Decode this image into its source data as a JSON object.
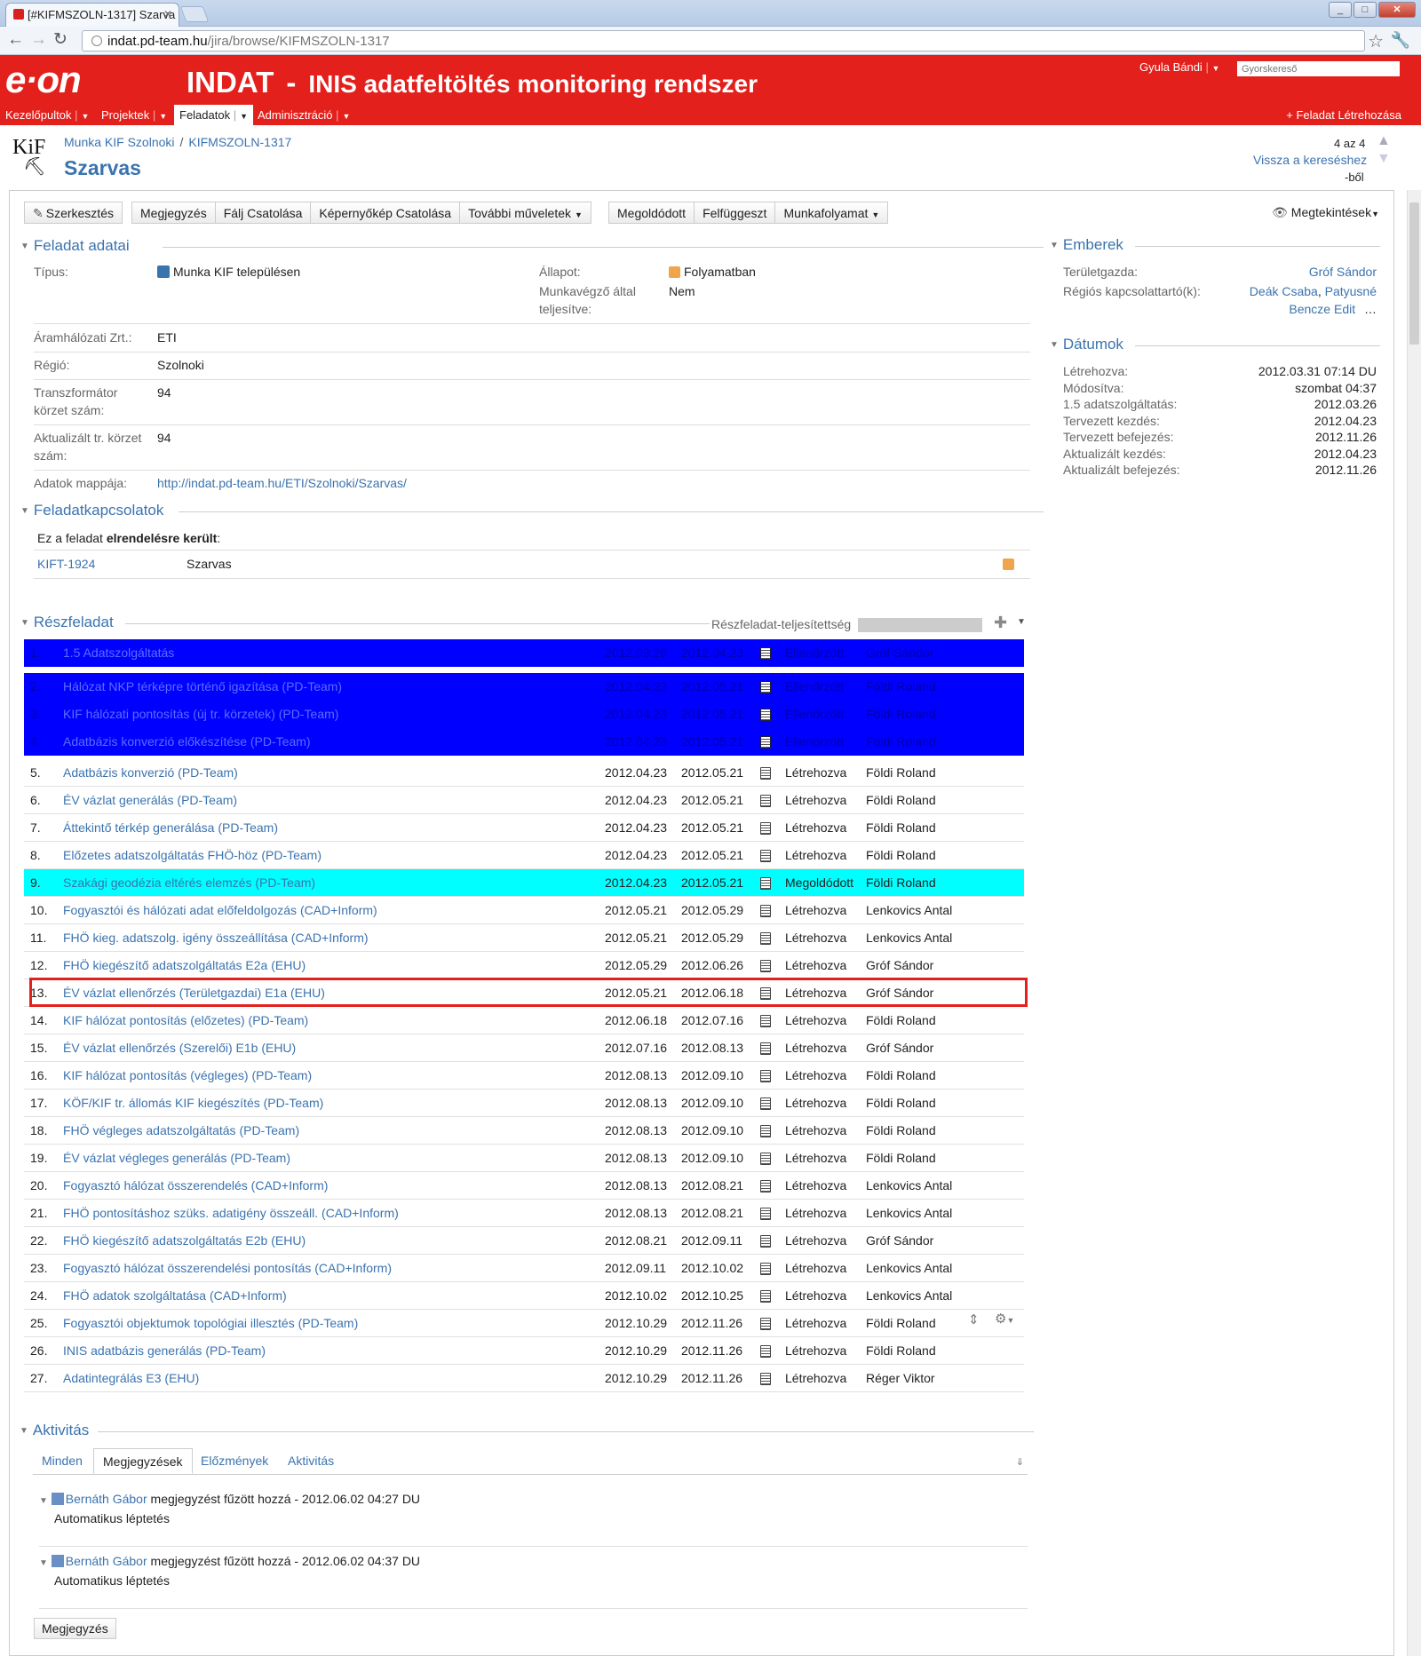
{
  "browser": {
    "tab_title": "[#KIFMSZOLN-1317] Szarva",
    "url_host": "indat.pd-team.hu",
    "url_path": "/jira/browse/KIFMSZOLN-1317"
  },
  "header": {
    "logo": "e·on",
    "app_name": "INDAT",
    "separator": "-",
    "app_subtitle": "INIS adatfeltöltés monitoring rendszer",
    "user": "Gyula Bándi",
    "search_placeholder": "Gyorskereső",
    "nav": [
      "Kezelőpultok",
      "Projektek",
      "Feladatok",
      "Adminisztráció"
    ],
    "create_issue": "+ Feladat Létrehozása"
  },
  "issue": {
    "project_avatar_text": "KiF",
    "breadcrumb_project": "Munka KIF Szolnoki",
    "breadcrumb_key": "KIFMSZOLN-1317",
    "summary": "Szarvas",
    "pager": "4 az 4",
    "back_link": "Vissza a kereséshez",
    "back_suffix": "-ből"
  },
  "toolbar": {
    "edit": "Szerkesztés",
    "group1": [
      "Megjegyzés",
      "Fálj Csatolása",
      "Képernyőkép Csatolása",
      "További műveletek"
    ],
    "group2": [
      "Megoldódott",
      "Felfüggeszt",
      "Munkafolyamat"
    ],
    "views": "Megtekintések"
  },
  "details": {
    "heading": "Feladat adatai",
    "type_label": "Típus:",
    "type_value": "Munka KIF településen",
    "status_label": "Állapot:",
    "status_value": "Folyamatban",
    "done_label_1": "Munkavégző által",
    "done_label_2": "teljesítve:",
    "done_value": "Nem",
    "fields": [
      {
        "label_1": "Áramhálózati Zrt.:",
        "label_2": "",
        "value": "ETI"
      },
      {
        "label_1": "Régió:",
        "label_2": "",
        "value": "Szolnoki"
      },
      {
        "label_1": "Transzformátor",
        "label_2": "körzet szám:",
        "value": "94"
      },
      {
        "label_1": "Aktualizált tr. körzet",
        "label_2": "szám:",
        "value": "94"
      }
    ],
    "folder_label": "Adatok mappája:",
    "folder_value": "http://indat.pd-team.hu/ETI/Szolnoki/Szarvas/"
  },
  "links": {
    "heading": "Feladatkapcsolatok",
    "relation_prefix": "Ez a feladat",
    "relation_bold": "elrendelésre került",
    "relation_suffix": ":",
    "key": "KIFT-1924",
    "summary": "Szarvas"
  },
  "subtasks": {
    "heading": "Részfeladat",
    "progress_label": "Részfeladat-teljesítettség",
    "rows": [
      {
        "num": "1.",
        "summary": "1.5 Adatszolgáltatás",
        "start": "2012.03.26",
        "end": "2012.04.23",
        "status": "Ellenőrzött",
        "assignee": "Gróf Sándor",
        "style": "blue"
      },
      {
        "num": "2.",
        "summary": "Hálózat NKP térképre történő igazítása (PD-Team)",
        "start": "2012.04.23",
        "end": "2012.05.21",
        "status": "Ellenőrzött",
        "assignee": "Földi Roland",
        "style": "blue"
      },
      {
        "num": "3.",
        "summary": "KIF hálózati pontosítás (új tr. körzetek) (PD-Team)",
        "start": "2012.04.23",
        "end": "2012.05.21",
        "status": "Ellenőrzött",
        "assignee": "Földi Roland",
        "style": "blue"
      },
      {
        "num": "4.",
        "summary": "Adatbázis konverzió előkészítése (PD-Team)",
        "start": "2012.04.23",
        "end": "2012.05.21",
        "status": "Ellenőrzött",
        "assignee": "Földi Roland",
        "style": "blue"
      },
      {
        "num": "5.",
        "summary": "Adatbázis konverzió (PD-Team)",
        "start": "2012.04.23",
        "end": "2012.05.21",
        "status": "Létrehozva",
        "assignee": "Földi Roland",
        "style": ""
      },
      {
        "num": "6.",
        "summary": "ÉV vázlat generálás (PD-Team)",
        "start": "2012.04.23",
        "end": "2012.05.21",
        "status": "Létrehozva",
        "assignee": "Földi Roland",
        "style": ""
      },
      {
        "num": "7.",
        "summary": "Áttekintő térkép generálása (PD-Team)",
        "start": "2012.04.23",
        "end": "2012.05.21",
        "status": "Létrehozva",
        "assignee": "Földi Roland",
        "style": ""
      },
      {
        "num": "8.",
        "summary": "Előzetes adatszolgáltatás FHÖ-höz (PD-Team)",
        "start": "2012.04.23",
        "end": "2012.05.21",
        "status": "Létrehozva",
        "assignee": "Földi Roland",
        "style": ""
      },
      {
        "num": "9.",
        "summary": "Szakági geodézia eltérés elemzés (PD-Team)",
        "start": "2012.04.23",
        "end": "2012.05.21",
        "status": "Megoldódott",
        "assignee": "Földi Roland",
        "style": "cyan"
      },
      {
        "num": "10.",
        "summary": "Fogyasztói és hálózati adat előfeldolgozás (CAD+Inform)",
        "start": "2012.05.21",
        "end": "2012.05.29",
        "status": "Létrehozva",
        "assignee": "Lenkovics Antal",
        "style": ""
      },
      {
        "num": "11.",
        "summary": "FHÖ kieg. adatszolg. igény összeállítása (CAD+Inform)",
        "start": "2012.05.21",
        "end": "2012.05.29",
        "status": "Létrehozva",
        "assignee": "Lenkovics Antal",
        "style": ""
      },
      {
        "num": "12.",
        "summary": "FHÖ kiegészítő adatszolgáltatás E2a (EHU)",
        "start": "2012.05.29",
        "end": "2012.06.26",
        "status": "Létrehozva",
        "assignee": "Gróf Sándor",
        "style": ""
      },
      {
        "num": "13.",
        "summary": "ÉV vázlat ellenőrzés (Területgazdai) E1a (EHU)",
        "start": "2012.05.21",
        "end": "2012.06.18",
        "status": "Létrehozva",
        "assignee": "Gróf Sándor",
        "style": "boxed"
      },
      {
        "num": "14.",
        "summary": "KIF hálózat pontosítás (előzetes) (PD-Team)",
        "start": "2012.06.18",
        "end": "2012.07.16",
        "status": "Létrehozva",
        "assignee": "Földi Roland",
        "style": ""
      },
      {
        "num": "15.",
        "summary": "ÉV vázlat ellenőrzés (Szerelői) E1b (EHU)",
        "start": "2012.07.16",
        "end": "2012.08.13",
        "status": "Létrehozva",
        "assignee": "Gróf Sándor",
        "style": ""
      },
      {
        "num": "16.",
        "summary": "KIF hálózat pontosítás (végleges) (PD-Team)",
        "start": "2012.08.13",
        "end": "2012.09.10",
        "status": "Létrehozva",
        "assignee": "Földi Roland",
        "style": ""
      },
      {
        "num": "17.",
        "summary": "KÖF/KIF tr. állomás KIF kiegészítés (PD-Team)",
        "start": "2012.08.13",
        "end": "2012.09.10",
        "status": "Létrehozva",
        "assignee": "Földi Roland",
        "style": ""
      },
      {
        "num": "18.",
        "summary": "FHÖ végleges adatszolgáltatás (PD-Team)",
        "start": "2012.08.13",
        "end": "2012.09.10",
        "status": "Létrehozva",
        "assignee": "Földi Roland",
        "style": ""
      },
      {
        "num": "19.",
        "summary": "ÉV vázlat végleges generálás (PD-Team)",
        "start": "2012.08.13",
        "end": "2012.09.10",
        "status": "Létrehozva",
        "assignee": "Földi Roland",
        "style": ""
      },
      {
        "num": "20.",
        "summary": "Fogyasztó hálózat összerendelés (CAD+Inform)",
        "start": "2012.08.13",
        "end": "2012.08.21",
        "status": "Létrehozva",
        "assignee": "Lenkovics Antal",
        "style": ""
      },
      {
        "num": "21.",
        "summary": "FHÖ pontosításhoz szüks. adatigény összeáll. (CAD+Inform)",
        "start": "2012.08.13",
        "end": "2012.08.21",
        "status": "Létrehozva",
        "assignee": "Lenkovics Antal",
        "style": ""
      },
      {
        "num": "22.",
        "summary": "FHÖ kiegészítő adatszolgáltatás E2b (EHU)",
        "start": "2012.08.21",
        "end": "2012.09.11",
        "status": "Létrehozva",
        "assignee": "Gróf Sándor",
        "style": ""
      },
      {
        "num": "23.",
        "summary": "Fogyasztó hálózat összerendelési pontosítás (CAD+Inform)",
        "start": "2012.09.11",
        "end": "2012.10.02",
        "status": "Létrehozva",
        "assignee": "Lenkovics Antal",
        "style": ""
      },
      {
        "num": "24.",
        "summary": "FHÖ adatok szolgáltatása (CAD+Inform)",
        "start": "2012.10.02",
        "end": "2012.10.25",
        "status": "Létrehozva",
        "assignee": "Lenkovics Antal",
        "style": ""
      },
      {
        "num": "25.",
        "summary": "Fogyasztói objektumok topológiai illesztés (PD-Team)",
        "start": "2012.10.29",
        "end": "2012.11.26",
        "status": "Létrehozva",
        "assignee": "Földi Roland",
        "style": ""
      },
      {
        "num": "26.",
        "summary": "INIS adatbázis generálás (PD-Team)",
        "start": "2012.10.29",
        "end": "2012.11.26",
        "status": "Létrehozva",
        "assignee": "Földi Roland",
        "style": ""
      },
      {
        "num": "27.",
        "summary": "Adatintegrálás E3 (EHU)",
        "start": "2012.10.29",
        "end": "2012.11.26",
        "status": "Létrehozva",
        "assignee": "Réger Viktor",
        "style": ""
      }
    ]
  },
  "activity": {
    "heading": "Aktivitás",
    "tabs": [
      "Minden",
      "Megjegyzések",
      "Előzmények",
      "Aktivitás"
    ],
    "comments": [
      {
        "author": "Bernáth Gábor",
        "action": " megjegyzést fűzött hozzá - 2012.06.02 04:27 DU",
        "body": "Automatikus léptetés"
      },
      {
        "author": "Bernáth Gábor",
        "action": " megjegyzést fűzött hozzá - 2012.06.02 04:37 DU",
        "body": "Automatikus léptetés"
      }
    ],
    "comment_button": "Megjegyzés"
  },
  "people": {
    "heading": "Emberek",
    "owner_label": "Területgazda:",
    "owner_value": "Gróf Sándor",
    "regional_label": "Régiós kapcsolattartó(k):",
    "regional_value_1": "Deák Csaba",
    "regional_value_2": "Patyusné",
    "regional_value_3": "Bencze Edit",
    "regional_more": "…"
  },
  "dates": {
    "heading": "Dátumok",
    "rows": [
      {
        "label": "Létrehozva:",
        "value": "2012.03.31 07:14 DU"
      },
      {
        "label": "Módosítva:",
        "value": "szombat 04:37"
      },
      {
        "label": "1.5 adatszolgáltatás:",
        "value": "2012.03.26"
      },
      {
        "label": "Tervezett kezdés:",
        "value": "2012.04.23"
      },
      {
        "label": "Tervezett befejezés:",
        "value": "2012.11.26"
      },
      {
        "label": "Aktualizált kezdés:",
        "value": "2012.04.23"
      },
      {
        "label": "Aktualizált befejezés:",
        "value": "2012.11.26"
      }
    ]
  },
  "colors": {
    "brand": "#e3201b",
    "link": "#3b73af",
    "checked_row": "#0000ff",
    "resolved_row": "#00ffff"
  }
}
